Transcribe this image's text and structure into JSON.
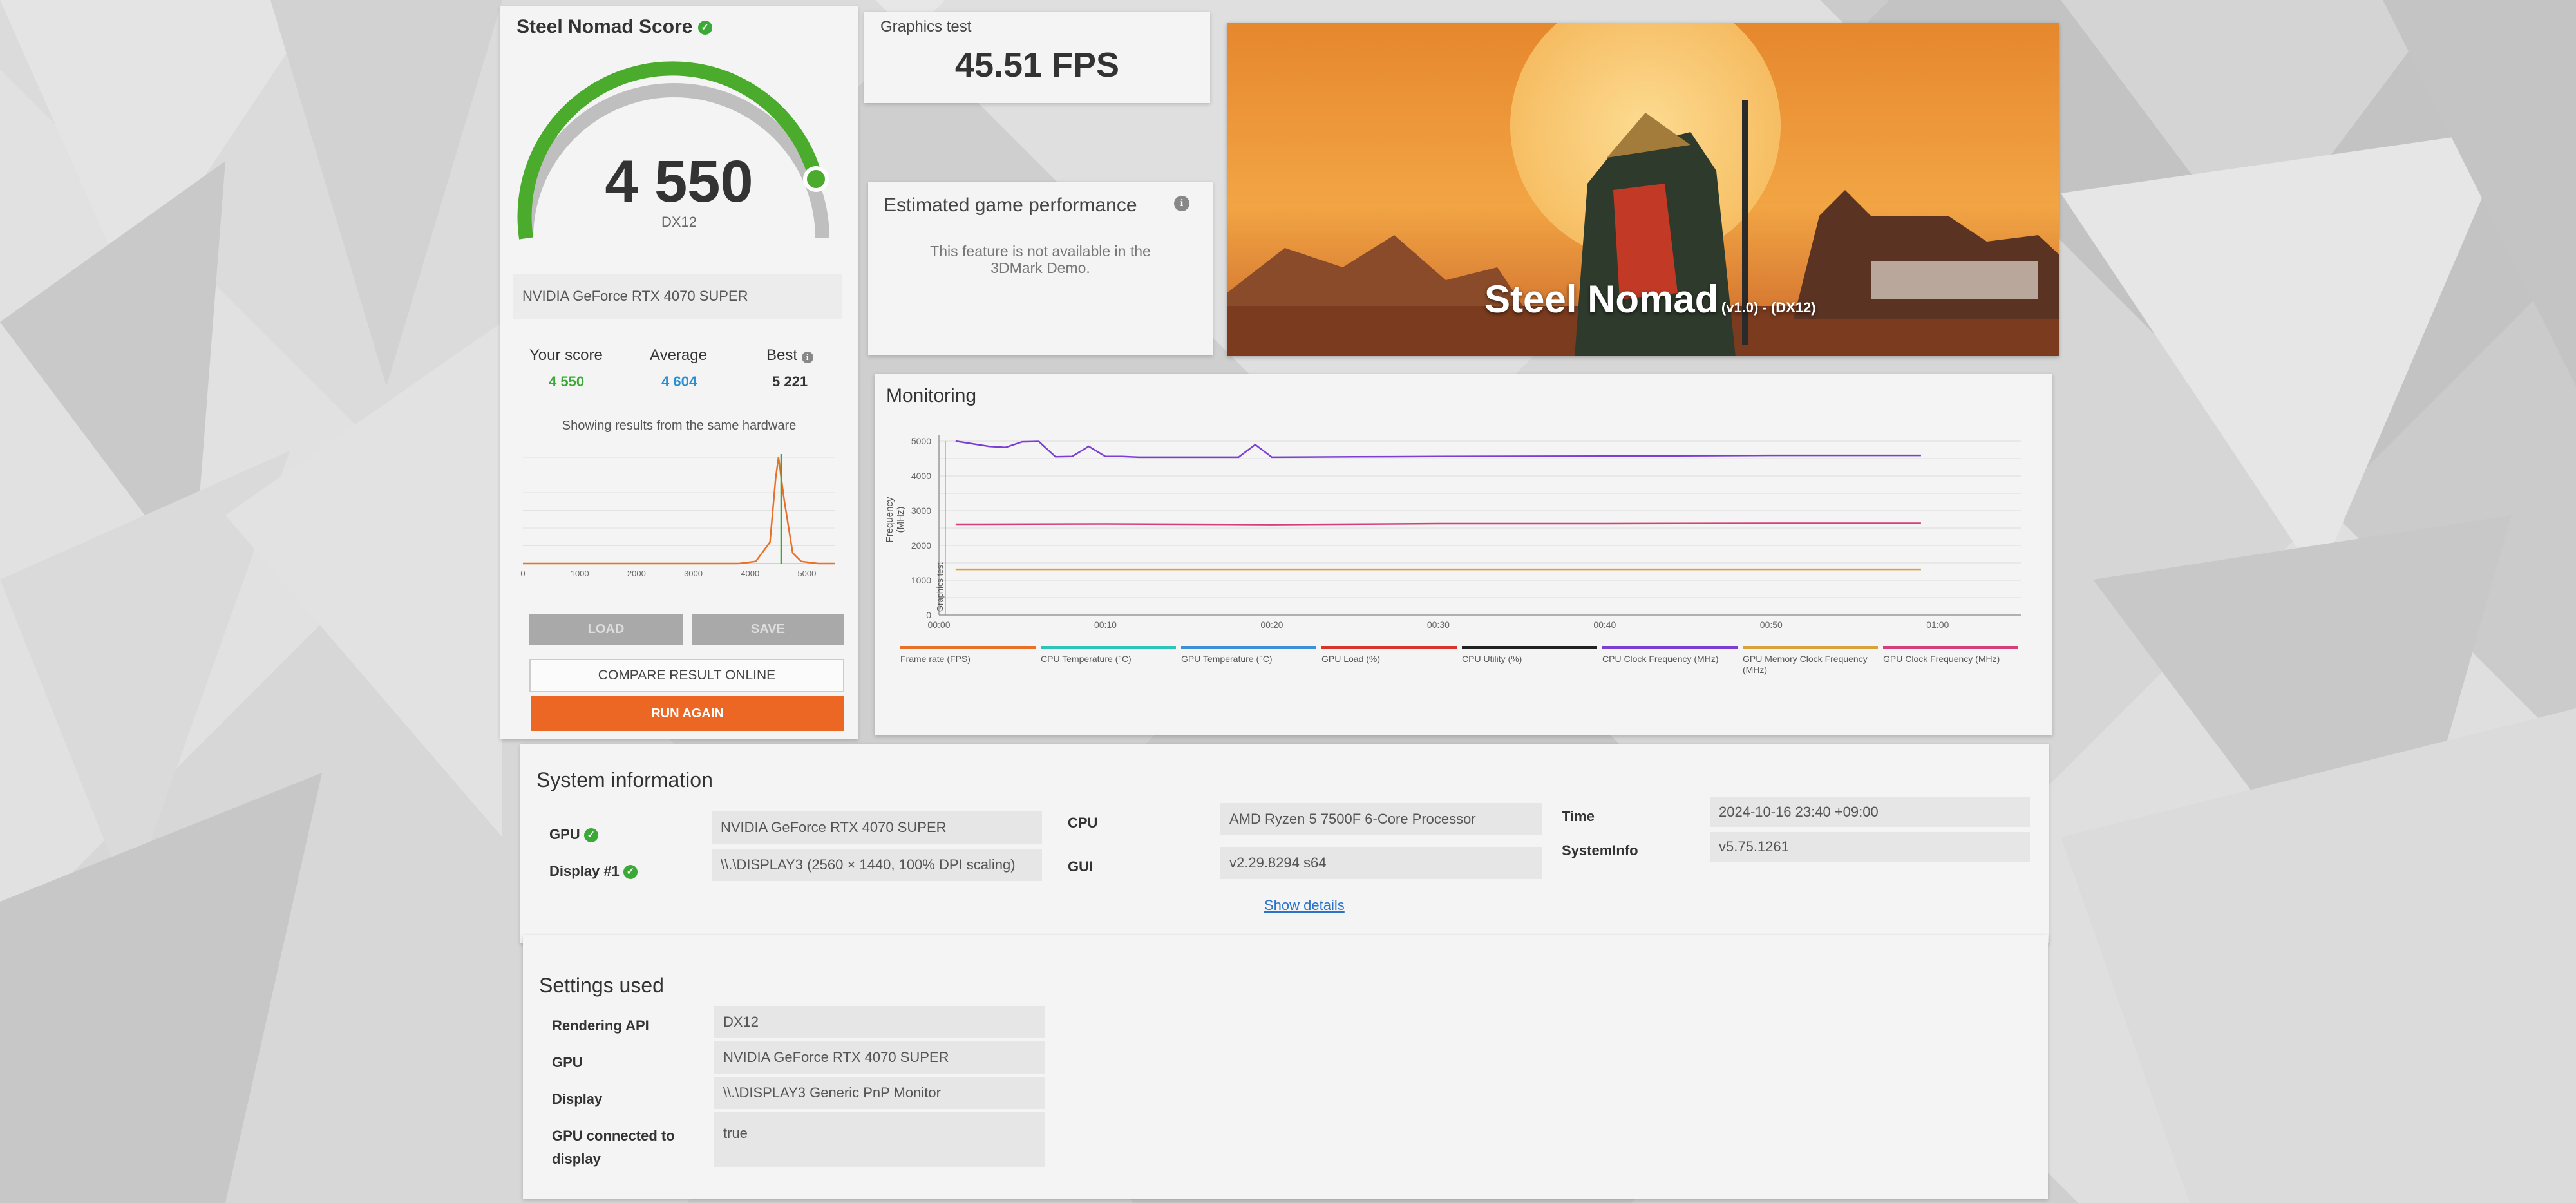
{
  "score_panel": {
    "title": "Steel Nomad Score",
    "score": "4 550",
    "api": "DX12",
    "gpu": "NVIDIA GeForce RTX 4070 SUPER",
    "your_score_label": "Your score",
    "your_score": "4 550",
    "average_label": "Average",
    "average": "4 604",
    "best_label": "Best",
    "best": "5 221",
    "same_hw_text": "Showing results from the same hardware",
    "histogram_ticks": [
      "0",
      "1000",
      "2000",
      "3000",
      "4000",
      "5000"
    ],
    "load_label": "LOAD",
    "save_label": "SAVE",
    "compare_label": "COMPARE RESULT ONLINE",
    "run_again_label": "RUN AGAIN"
  },
  "graphics_test": {
    "label": "Graphics test",
    "fps": "45.51 FPS"
  },
  "estimated": {
    "title": "Estimated game performance",
    "message": "This feature is not available in the 3DMark Demo."
  },
  "banner": {
    "title": "Steel Nomad",
    "subtitle": "(v1.0) - (DX12)"
  },
  "monitoring": {
    "title": "Monitoring",
    "y_axis_label": "Frequency (MHz)",
    "marker_label": "Graphics test",
    "legend": [
      {
        "label": "Frame rate (FPS)",
        "color": "#e8712a"
      },
      {
        "label": "CPU Temperature (°C)",
        "color": "#2fc4b8"
      },
      {
        "label": "GPU Temperature (°C)",
        "color": "#3d8fd6"
      },
      {
        "label": "GPU Load (%)",
        "color": "#d9342b"
      },
      {
        "label": "CPU Utility (%)",
        "color": "#222222"
      },
      {
        "label": "CPU Clock Frequency (MHz)",
        "color": "#7b3fd1"
      },
      {
        "label": "GPU Memory Clock Frequency (MHz)",
        "color": "#d9a23a"
      },
      {
        "label": "GPU Clock Frequency (MHz)",
        "color": "#d63f7a"
      }
    ]
  },
  "chart_data": {
    "type": "line",
    "title": "Monitoring",
    "ylabel": "Frequency (MHz)",
    "xlabel": "",
    "x_ticks": [
      "00:00",
      "00:10",
      "00:20",
      "00:30",
      "00:40",
      "00:50",
      "01:00"
    ],
    "y_ticks": [
      "0",
      "1000",
      "2000",
      "3000",
      "4000",
      "5000"
    ],
    "ylim": [
      0,
      5000
    ],
    "xlim": [
      0,
      65
    ],
    "series": [
      {
        "name": "CPU Clock Frequency (MHz)",
        "color": "#7b3fd1",
        "x": [
          1,
          3,
          4,
          5,
          6,
          7,
          8,
          9,
          10,
          11,
          12,
          14,
          18,
          19,
          20,
          25,
          30,
          40,
          50,
          59
        ],
        "values": [
          5000,
          4850,
          4820,
          4980,
          4990,
          4550,
          4560,
          4850,
          4560,
          4560,
          4540,
          4540,
          4540,
          4900,
          4540,
          4550,
          4560,
          4570,
          4590,
          4590
        ]
      },
      {
        "name": "GPU Clock Frequency (MHz)",
        "color": "#d63f7a",
        "x": [
          1,
          10,
          20,
          30,
          40,
          50,
          59
        ],
        "values": [
          2610,
          2620,
          2600,
          2630,
          2630,
          2640,
          2640
        ]
      },
      {
        "name": "GPU Memory Clock Frequency (MHz)",
        "color": "#d9a23a",
        "x": [
          1,
          10,
          20,
          30,
          40,
          50,
          59
        ],
        "values": [
          1313,
          1313,
          1313,
          1313,
          1313,
          1313,
          1313
        ]
      }
    ]
  },
  "histogram_data": {
    "type": "line",
    "xlim": [
      0,
      5500
    ],
    "series": [
      {
        "name": "results",
        "color": "#e8712a",
        "x": [
          0,
          3800,
          4100,
          4350,
          4450,
          4500,
          4600,
          4750,
          4900,
          5200,
          5500
        ],
        "values": [
          0,
          0,
          2,
          20,
          80,
          100,
          60,
          10,
          2,
          0,
          0
        ]
      }
    ],
    "marker_value": 4550
  },
  "system_info": {
    "title": "System information",
    "gpu_label": "GPU",
    "gpu_value": "NVIDIA GeForce RTX 4070 SUPER",
    "display_label": "Display #1",
    "display_value": "\\\\.\\DISPLAY3 (2560 × 1440, 100% DPI scaling)",
    "cpu_label": "CPU",
    "cpu_value": "AMD Ryzen 5 7500F 6-Core Processor",
    "gui_label": "GUI",
    "gui_value": "v2.29.8294 s64",
    "time_label": "Time",
    "time_value": "2024-10-16 23:40 +09:00",
    "sysinfo_label": "SystemInfo",
    "sysinfo_value": "v5.75.1261",
    "show_details": "Show details"
  },
  "settings": {
    "title": "Settings used",
    "rows": [
      {
        "label": "Rendering API",
        "value": "DX12"
      },
      {
        "label": "GPU",
        "value": "NVIDIA GeForce RTX 4070 SUPER"
      },
      {
        "label": "Display",
        "value": "\\\\.\\DISPLAY3 Generic PnP Monitor"
      },
      {
        "label": "GPU connected to display",
        "value": "true"
      }
    ]
  }
}
